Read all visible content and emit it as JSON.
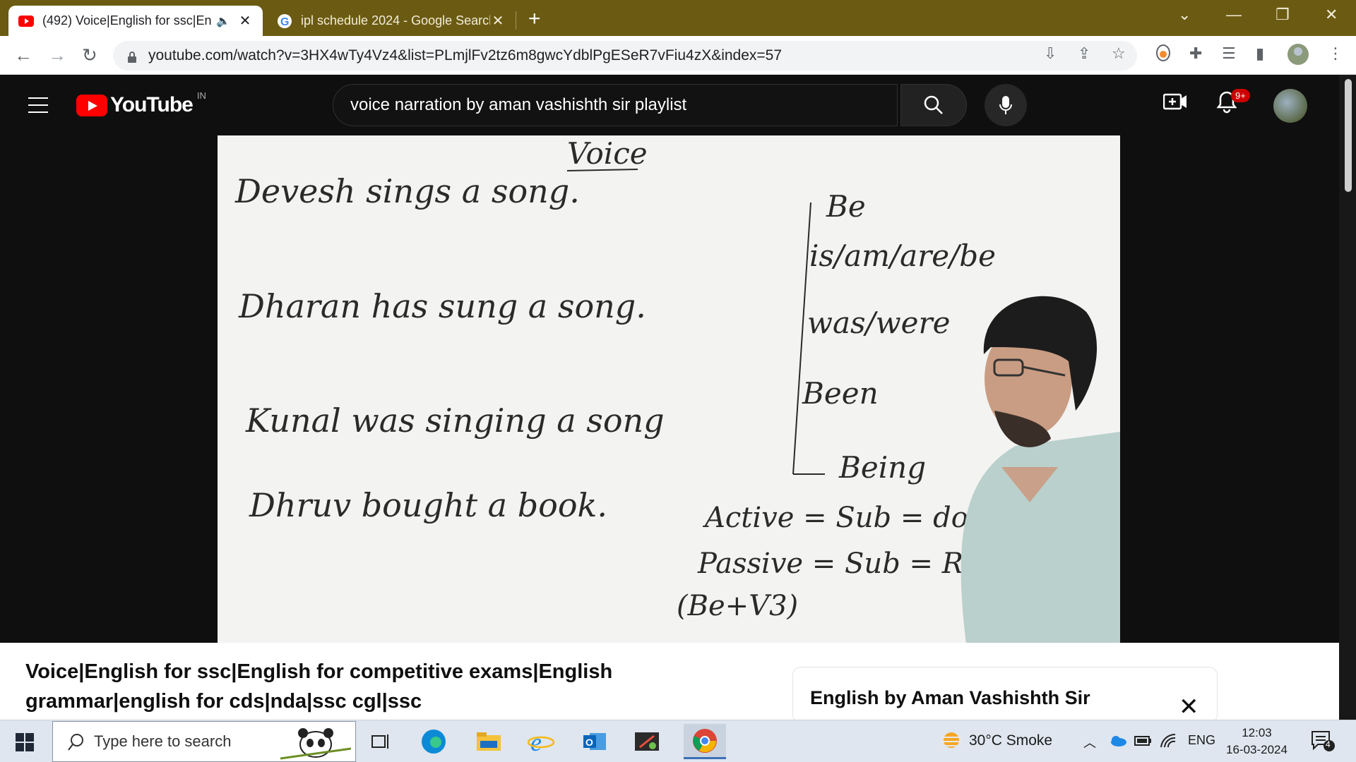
{
  "browser": {
    "tabs": [
      {
        "title": "(492) Voice|English for ssc|En",
        "active": true,
        "icon": "youtube-icon"
      },
      {
        "title": "ipl schedule 2024 - Google Search",
        "active": false,
        "icon": "google-icon"
      }
    ],
    "url": "youtube.com/watch?v=3HX4wTy4Vz4&list=PLmjlFv2tz6m8gwcYdblPgESeR7vFiu4zX&index=57"
  },
  "youtube": {
    "logo_text": "YouTube",
    "country": "IN",
    "search_value": "voice narration by aman vashishth sir playlist",
    "notification_count": "9+"
  },
  "video": {
    "board": {
      "heading": "Voice",
      "sentences": [
        "Devesh sings a song.",
        "Dharan has sung a song.",
        "Kunal was singing a song",
        "Dhruv bought a book."
      ],
      "be_forms": [
        "Be",
        "is/am/are/be",
        "was/were",
        "Been",
        "Being"
      ],
      "active_line": "Active = Sub = doer",
      "passive_line": "Passive = Sub = Receive",
      "formula": "(Be+V3)"
    },
    "title": "Voice|English for ssc|English for competitive exams|English grammar|english for cds|nda|ssc cgl|ssc"
  },
  "playlist": {
    "title": "English by Aman Vashishth Sir"
  },
  "taskbar": {
    "search_placeholder": "Type here to search",
    "weather": "30°C  Smoke",
    "language": "ENG",
    "time": "12:03",
    "date": "16-03-2024",
    "notification_count": "4"
  }
}
